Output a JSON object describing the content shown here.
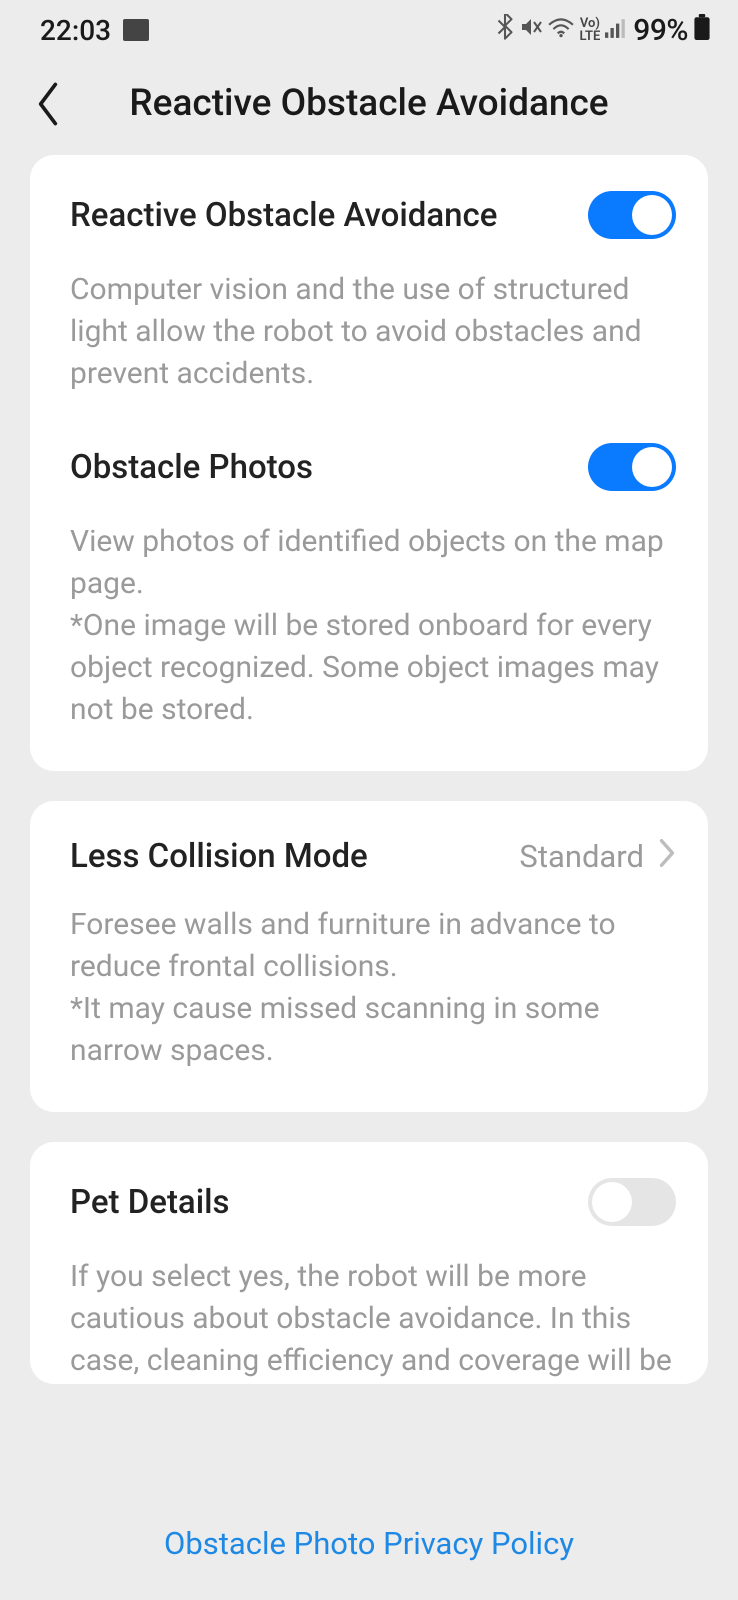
{
  "statusBar": {
    "time": "22:03",
    "battery": "99%"
  },
  "appBar": {
    "title": "Reactive Obstacle Avoidance"
  },
  "settings": {
    "obstacleAvoidance": {
      "title": "Reactive Obstacle Avoidance",
      "description": "Computer vision and the use of structured light allow the robot to avoid obstacles and prevent accidents.",
      "enabled": true
    },
    "obstaclePhotos": {
      "title": "Obstacle Photos",
      "description": "View photos of identified objects on the map page.\n*One image will be stored onboard for every object recognized. Some object images may not be stored.",
      "enabled": true
    },
    "lessCollision": {
      "title": "Less Collision Mode",
      "value": "Standard",
      "description": "Foresee walls and furniture in advance to reduce frontal collisions.\n*It may cause missed scanning in some narrow spaces."
    },
    "petDetails": {
      "title": "Pet Details",
      "description": "If you select yes, the robot will be more cautious about obstacle avoidance. In this case, cleaning efficiency and coverage will be slightly reduced.",
      "enabled": false
    }
  },
  "footer": {
    "link": "Obstacle Photo Privacy Policy"
  }
}
